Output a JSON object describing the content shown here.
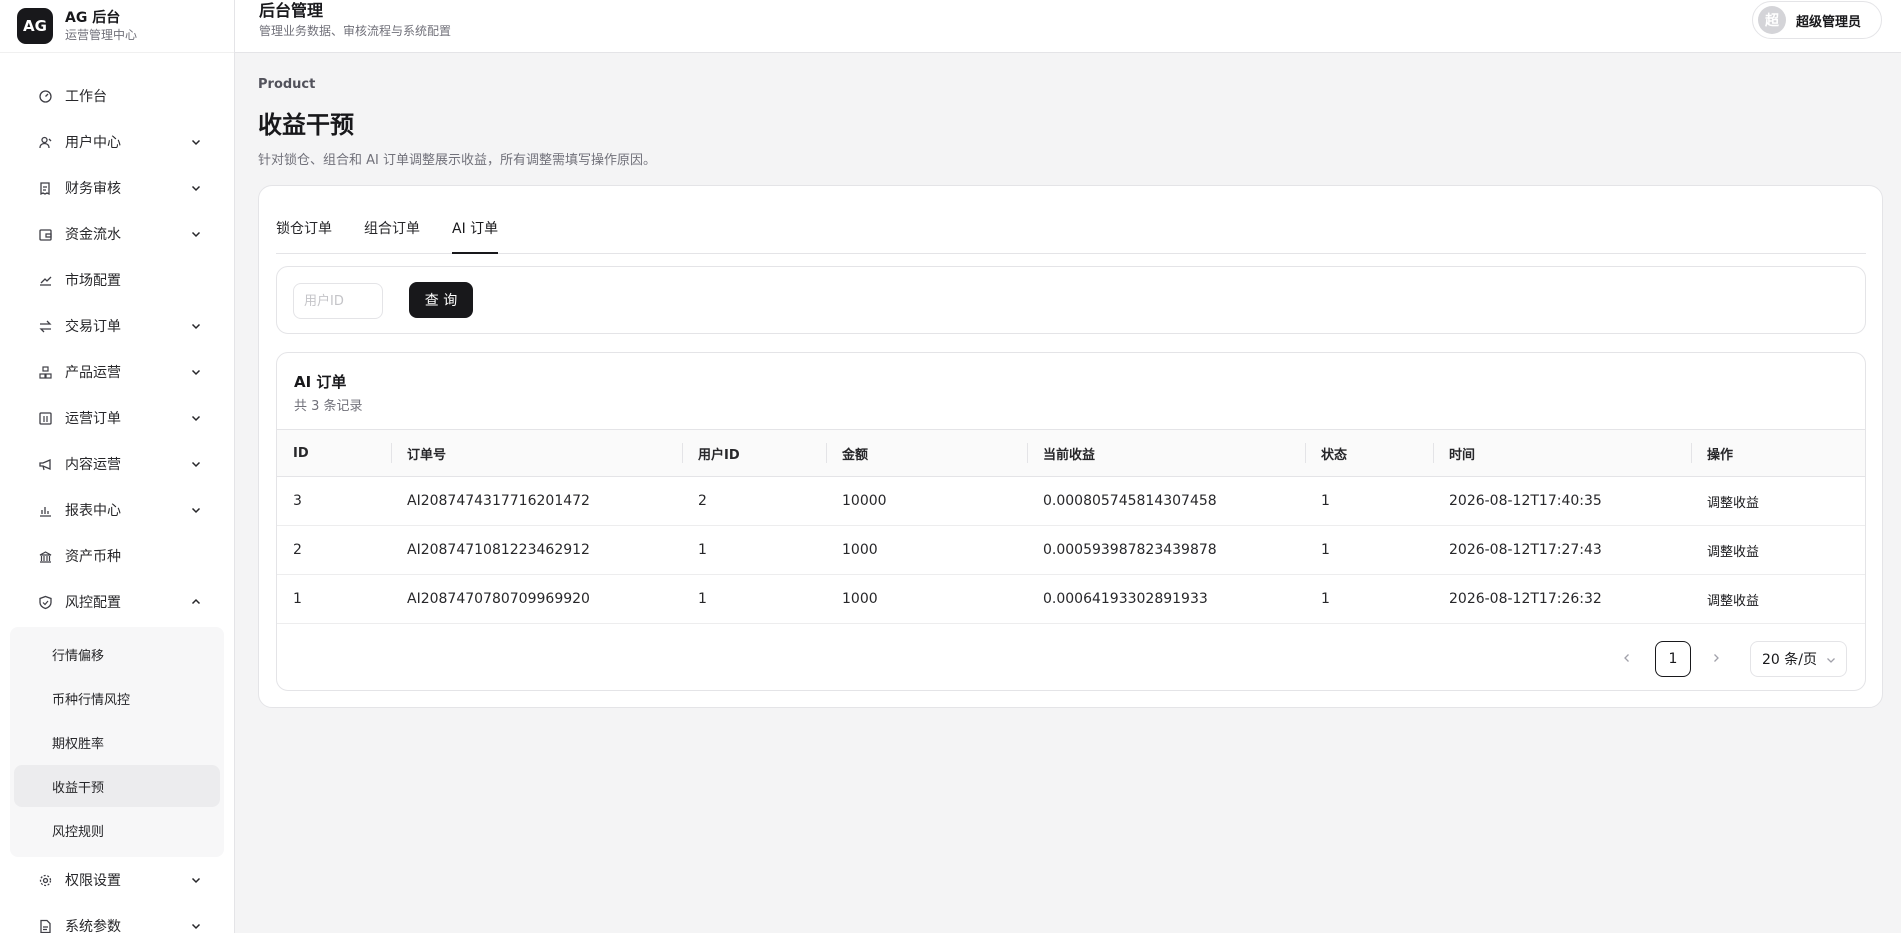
{
  "brand": {
    "logo": "AG",
    "title": "AG 后台",
    "subtitle": "运营管理中心"
  },
  "sidebar": {
    "items": [
      {
        "label": "工作台",
        "icon": "dashboard-icon",
        "expandable": false
      },
      {
        "label": "用户中心",
        "icon": "user-icon",
        "expandable": true
      },
      {
        "label": "财务审核",
        "icon": "receipt-icon",
        "expandable": true
      },
      {
        "label": "资金流水",
        "icon": "wallet-icon",
        "expandable": true
      },
      {
        "label": "市场配置",
        "icon": "trend-icon",
        "expandable": false
      },
      {
        "label": "交易订单",
        "icon": "swap-icon",
        "expandable": true
      },
      {
        "label": "产品运营",
        "icon": "boxes-icon",
        "expandable": true
      },
      {
        "label": "运营订单",
        "icon": "columns-icon",
        "expandable": true
      },
      {
        "label": "内容运营",
        "icon": "megaphone-icon",
        "expandable": true
      },
      {
        "label": "报表中心",
        "icon": "bar-chart-icon",
        "expandable": true
      },
      {
        "label": "资产币种",
        "icon": "bank-icon",
        "expandable": false
      },
      {
        "label": "风控配置",
        "icon": "shield-icon",
        "expandable": true,
        "expanded": true
      },
      {
        "label": "权限设置",
        "icon": "gear-icon",
        "expandable": true
      },
      {
        "label": "系统参数",
        "icon": "document-icon",
        "expandable": true
      }
    ],
    "risk_submenu": [
      "行情偏移",
      "币种行情风控",
      "期权胜率",
      "收益干预",
      "风控规则"
    ],
    "active_sub": "收益干预"
  },
  "header": {
    "title": "后台管理",
    "subtitle": "管理业务数据、审核流程与系统配置",
    "avatar_char": "超",
    "user_name": "超级管理员"
  },
  "page": {
    "eyebrow": "Product",
    "title": "收益干预",
    "description": "针对锁仓、组合和 AI 订单调整展示收益，所有调整需填写操作原因。"
  },
  "tabs": [
    "锁仓订单",
    "组合订单",
    "AI 订单"
  ],
  "active_tab": "AI 订单",
  "filter": {
    "user_id_placeholder": "用户ID",
    "query_label": "查 询"
  },
  "table": {
    "title": "AI 订单",
    "count_text": "共 3 条记录",
    "columns": [
      "ID",
      "订单号",
      "用户ID",
      "金额",
      "当前收益",
      "状态",
      "时间",
      "操作"
    ],
    "rows": [
      [
        "3",
        "AI2087474317716201472",
        "2",
        "10000",
        "0.000805745814307458",
        "1",
        "2026-08-12T17:40:35",
        "调整收益"
      ],
      [
        "2",
        "AI2087471081223462912",
        "1",
        "1000",
        "0.000593987823439878",
        "1",
        "2026-08-12T17:27:43",
        "调整收益"
      ],
      [
        "1",
        "AI2087470780709969920",
        "1",
        "1000",
        "0.00064193302891933",
        "1",
        "2026-08-12T17:26:32",
        "调整收益"
      ]
    ]
  },
  "pagination": {
    "current_page": "1",
    "page_size": "20 条/页"
  }
}
